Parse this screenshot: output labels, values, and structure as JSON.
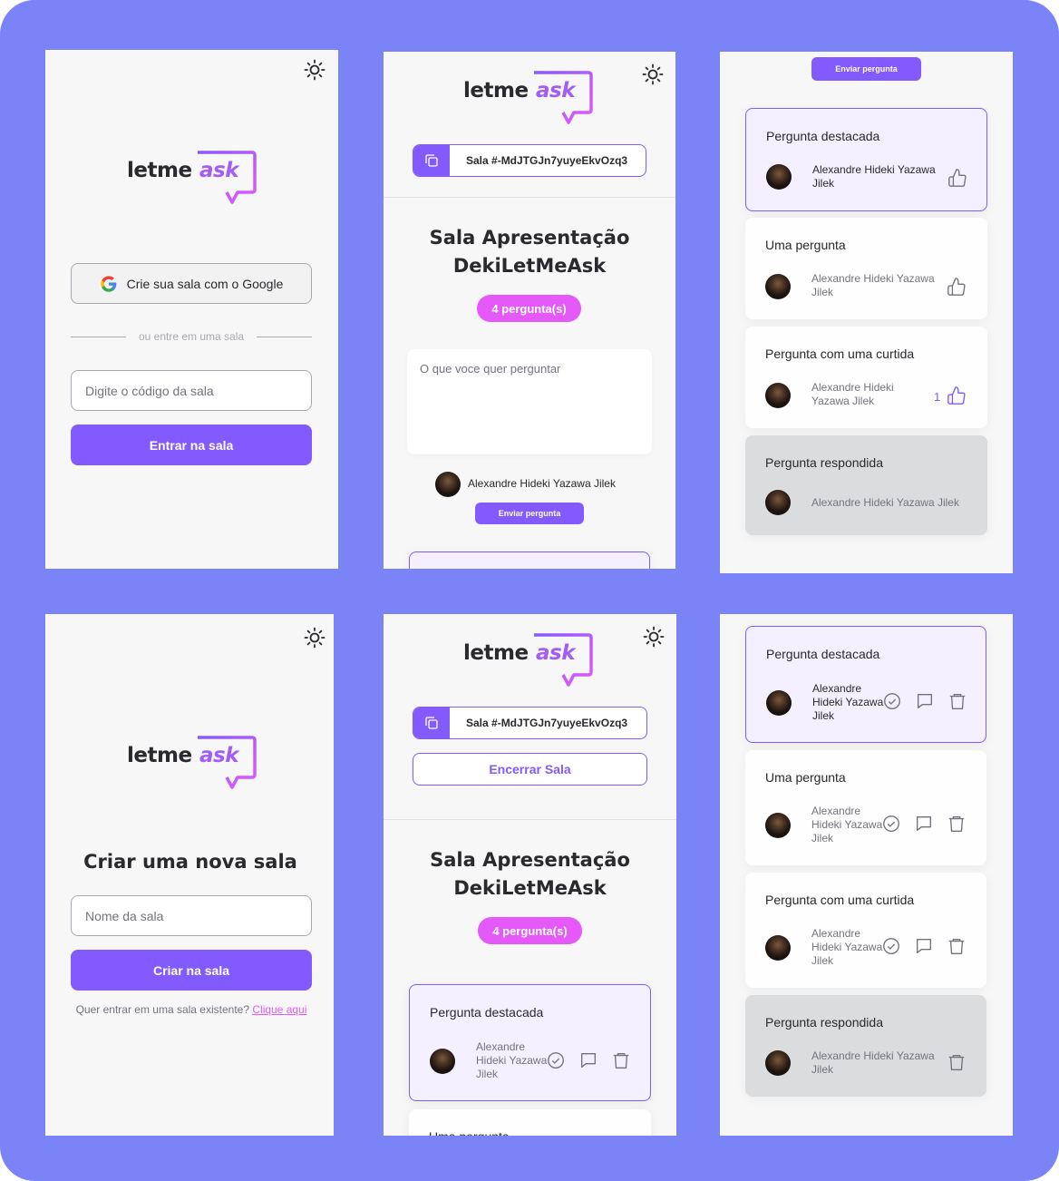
{
  "colors": {
    "frame": "#7a84f7",
    "primary": "#835afd",
    "pink": "#e559f9",
    "panel": "#f7f7f7"
  },
  "logo": {
    "letme": "letme",
    "ask": "ask"
  },
  "home": {
    "google_button": "Crie sua sala com o Google",
    "separator": "ou entre em uma sala",
    "room_code_placeholder": "Digite o código da sala",
    "enter_button": "Entrar na sala"
  },
  "new_room": {
    "title": "Criar uma nova sala",
    "room_name_placeholder": "Nome da sala",
    "create_button": "Criar na sala",
    "existing_text": "Quer entrar em uma sala existente?",
    "existing_link": "Clique aqui"
  },
  "room": {
    "code_label": "Sala #-MdJTGJn7yuyeEkvOzq3",
    "title_line1": "Sala Apresentação",
    "title_line2": "DekiLetMeAsk",
    "question_count": "4 pergunta(s)",
    "question_placeholder": "O que voce quer perguntar",
    "user_name": "Alexandre Hideki Yazawa Jilek",
    "send_button": "Enviar pergunta",
    "end_room_button": "Encerrar Sala"
  },
  "questions": [
    {
      "text": "Pergunta destacada",
      "author": "Alexandre Hideki Yazawa Jilek",
      "highlighted": true,
      "answered": false
    },
    {
      "text": "Uma pergunta",
      "author": "Alexandre Hideki Yazawa Jilek",
      "highlighted": false,
      "answered": false
    },
    {
      "text": "Pergunta com uma curtida",
      "author": "Alexandre Hideki Yazawa Jilek",
      "likes": "1",
      "highlighted": false,
      "answered": false
    },
    {
      "text": "Pergunta respondida",
      "author": "Alexandre Hideki Yazawa Jilek",
      "highlighted": false,
      "answered": true
    }
  ]
}
